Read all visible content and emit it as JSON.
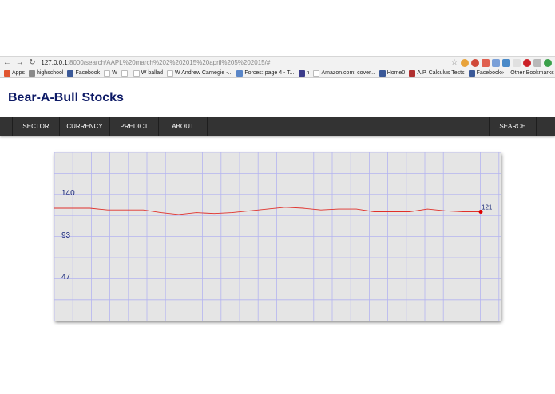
{
  "browser": {
    "url_host": "127.0.0.1",
    "url_path": ":8000/search/AAPL%20march%202%202015%20april%205%202015/#",
    "bookmarks": [
      {
        "label": "Apps",
        "icon": "apps-grid-icon",
        "color": "#e0552f"
      },
      {
        "label": "highschool",
        "icon": "folder-icon",
        "color": "#8a8a8a"
      },
      {
        "label": "Facebook",
        "icon": "facebook-icon",
        "color": "#3b5998"
      },
      {
        "label": "W",
        "icon": "wikipedia-icon",
        "color": "#ffffff"
      },
      {
        "label": "",
        "icon": "page-icon",
        "color": "#ffffff"
      },
      {
        "label": "W ballad",
        "icon": "wikipedia-icon",
        "color": "#ffffff"
      },
      {
        "label": "W Andrew Carnegie -...",
        "icon": "wikipedia-icon",
        "color": "#ffffff"
      },
      {
        "label": "Forces: page 4 - T...",
        "icon": "page-icon",
        "color": "#5a86c8"
      },
      {
        "label": "n",
        "icon": "n-icon",
        "color": "#3b3b8a"
      },
      {
        "label": "Amazon.com: cover...",
        "icon": "amazon-icon",
        "color": "#ffffff"
      },
      {
        "label": "Home0",
        "icon": "facebook-icon",
        "color": "#3b5998"
      },
      {
        "label": "A.P. Calculus Tests",
        "icon": "page-icon",
        "color": "#b03030"
      },
      {
        "label": "Facebook",
        "icon": "facebook-icon",
        "color": "#3b5998"
      }
    ],
    "overflow_label": "»",
    "other_bookmarks": "Other Bookmarks"
  },
  "site": {
    "title": "Bear-A-Bull Stocks"
  },
  "nav": {
    "items": [
      "SECTOR",
      "CURRENCY",
      "PREDICT",
      "ABOUT"
    ],
    "search": "SEARCH"
  },
  "chart_data": {
    "type": "line",
    "title": "",
    "xlabel": "",
    "ylabel": "",
    "yticks": [
      "140",
      "93",
      "47"
    ],
    "ylim": [
      0,
      187
    ],
    "grid": true,
    "last_label": "121",
    "series": [
      {
        "values": [
          125,
          125,
          125,
          123,
          123,
          123,
          120,
          118,
          120,
          119,
          120,
          122,
          124,
          126,
          125,
          123,
          124,
          124,
          121,
          121,
          121,
          124,
          122,
          121,
          121
        ],
        "color": "#e0302a"
      }
    ]
  }
}
